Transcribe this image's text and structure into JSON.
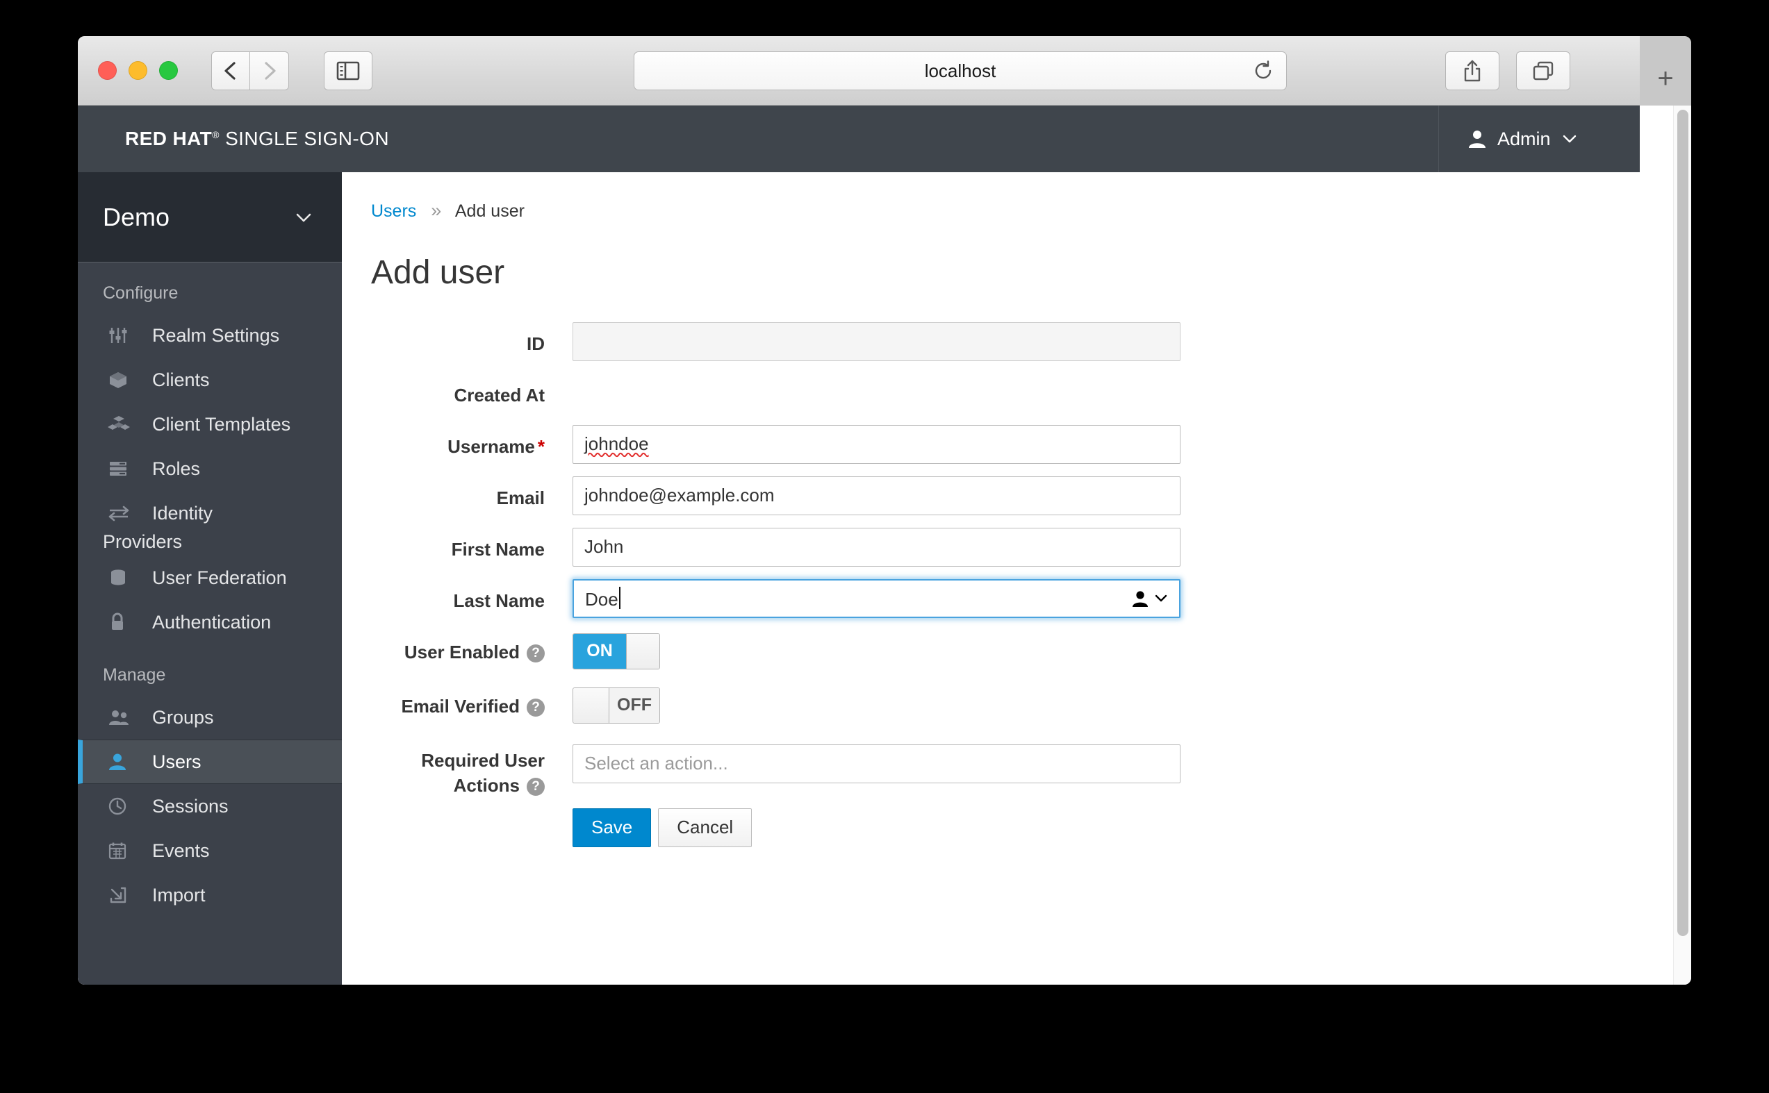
{
  "browser": {
    "url": "localhost",
    "buttons": {
      "back": "back-button",
      "forward": "forward-button",
      "sidebar": "sidebar-toggle",
      "share": "share-button",
      "tabs": "tab-overview-button",
      "newtab": "+",
      "reload": "reload-button"
    }
  },
  "appheader": {
    "brand_bold": "RED HAT",
    "brand_reg": "®",
    "brand_rest": "SINGLE SIGN-ON",
    "user": "Admin"
  },
  "sidebar": {
    "realm": "Demo",
    "sections": [
      {
        "label": "Configure",
        "items": [
          {
            "label": "Realm Settings",
            "icon": "sliders-icon",
            "active": false
          },
          {
            "label": "Clients",
            "icon": "cube-icon",
            "active": false
          },
          {
            "label": "Client Templates",
            "icon": "cubes-icon",
            "active": false
          },
          {
            "label": "Roles",
            "icon": "list-icon",
            "active": false
          },
          {
            "label": "Identity",
            "icon": "exchange-icon",
            "active": false,
            "second_line": "Providers"
          },
          {
            "label": "User Federation",
            "icon": "database-icon",
            "active": false
          },
          {
            "label": "Authentication",
            "icon": "lock-icon",
            "active": false
          }
        ]
      },
      {
        "label": "Manage",
        "items": [
          {
            "label": "Groups",
            "icon": "users-icon",
            "active": false
          },
          {
            "label": "Users",
            "icon": "user-icon",
            "active": true
          },
          {
            "label": "Sessions",
            "icon": "clock-icon",
            "active": false
          },
          {
            "label": "Events",
            "icon": "calendar-icon",
            "active": false
          },
          {
            "label": "Import",
            "icon": "import-icon",
            "active": false
          }
        ]
      }
    ]
  },
  "breadcrumb": {
    "parent": "Users",
    "separator": "»",
    "current": "Add user"
  },
  "page": {
    "title": "Add user"
  },
  "form": {
    "fields": {
      "id": {
        "label": "ID",
        "value": "",
        "disabled": true
      },
      "created_at": {
        "label": "Created At",
        "value": ""
      },
      "username": {
        "label": "Username",
        "required": "*",
        "value": "johndoe"
      },
      "email": {
        "label": "Email",
        "value": "johndoe@example.com"
      },
      "first_name": {
        "label": "First Name",
        "value": "John"
      },
      "last_name": {
        "label": "Last Name",
        "value": "Doe",
        "focused": true
      },
      "user_enabled": {
        "label": "User Enabled",
        "state": "ON"
      },
      "email_verified": {
        "label": "Email Verified",
        "state": "OFF"
      },
      "required_actions": {
        "label_line1": "Required User",
        "label_line2": "Actions",
        "placeholder": "Select an action..."
      }
    },
    "buttons": {
      "save": "Save",
      "cancel": "Cancel"
    }
  },
  "colors": {
    "accent_blue": "#0088ce",
    "toggle_blue": "#29a3dd",
    "active_bar": "#39a5dc",
    "header_bg": "#3f454c",
    "sidebar_bg": "#3c414a",
    "realm_bg": "#272c33",
    "required_red": "#cc0000"
  }
}
